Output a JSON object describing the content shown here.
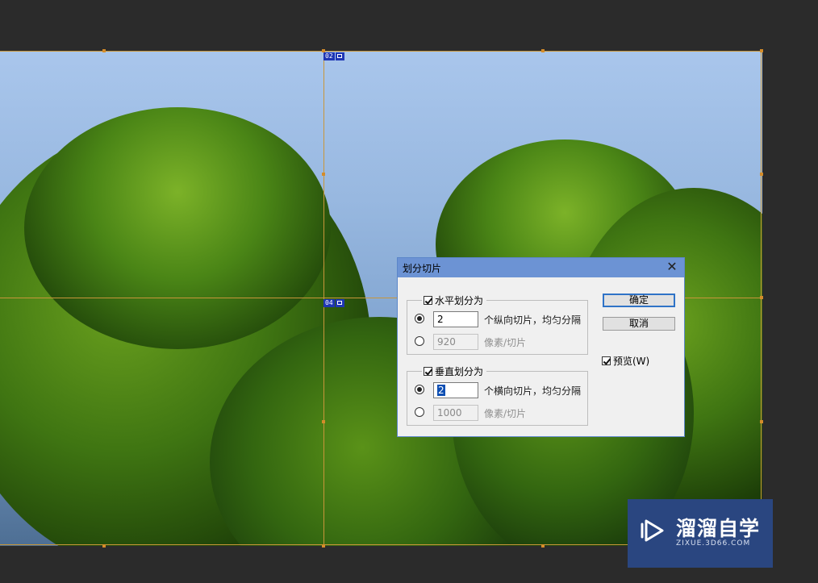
{
  "slices": [
    {
      "label": "02"
    },
    {
      "label": "04"
    }
  ],
  "dialog": {
    "title": "划分切片",
    "close_glyph": "✕",
    "horizontal": {
      "checkbox_label": "水平划分为",
      "checked": true,
      "count_value": "2",
      "count_suffix": "个纵向切片，均匀分隔",
      "pixels_value": "920",
      "pixels_suffix": "像素/切片"
    },
    "vertical": {
      "checkbox_label": "垂直划分为",
      "checked": true,
      "count_value": "2",
      "count_suffix": "个横向切片，均匀分隔",
      "pixels_value": "1000",
      "pixels_suffix": "像素/切片"
    },
    "ok_label": "确定",
    "cancel_label": "取消",
    "preview_label": "预览(W)",
    "preview_checked": true
  },
  "watermark": {
    "name": "溜溜自学",
    "url": "ZIXUE.3D66.COM"
  },
  "colors": {
    "slice_line": "#c8963a",
    "badge": "#1f36b4",
    "dialog_title": "#6c93d4",
    "watermark_bg": "#2a4680"
  },
  "icons": [
    "image-slice-icon",
    "close-icon",
    "checkbox-icon",
    "radio-icon",
    "play-logo-icon"
  ]
}
